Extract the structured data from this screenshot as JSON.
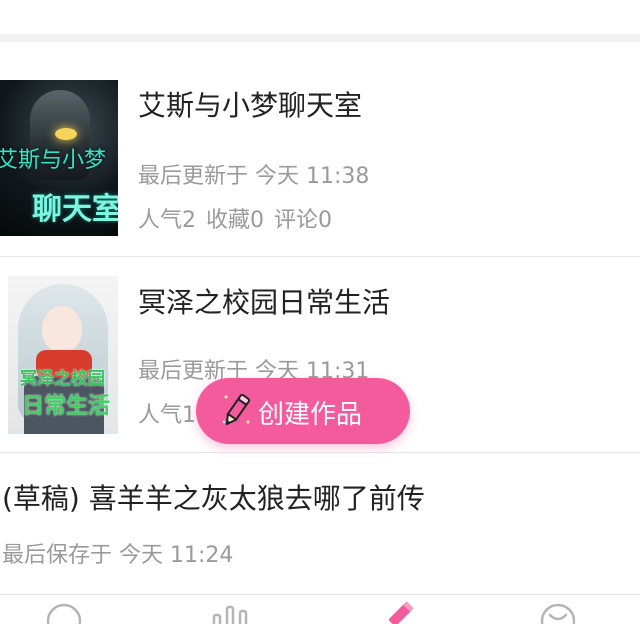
{
  "works": [
    {
      "title": "艾斯与小梦聊天室",
      "updated": "最后更新于 今天 11:38",
      "stats": {
        "popularity": "人气2",
        "favorites": "收藏0",
        "comments": "评论0"
      },
      "cover_text_top": "艾斯与小梦",
      "cover_text_big": "聊天室"
    },
    {
      "title": "冥泽之校园日常生活",
      "updated": "最后更新于 今天 11:31",
      "stats": {
        "popularity": "人气1"
      },
      "cover_text_top": "冥泽之校园",
      "cover_text_big": "日常生活"
    }
  ],
  "draft": {
    "title": "(草稿) 喜羊羊之灰太狼去哪了前传",
    "saved": "最后保存于 今天 11:24"
  },
  "fab": {
    "label": "创建作品",
    "icon": "pencil-icon"
  },
  "tabbar": {
    "tabs": [
      {
        "icon": "chat-bubble-icon"
      },
      {
        "icon": "bar-chart-icon"
      },
      {
        "icon": "pencil-icon",
        "active": true
      },
      {
        "icon": "profile-icon"
      }
    ]
  },
  "colors": {
    "accent": "#f45b9c",
    "title_text": "#222222",
    "meta_text": "#9a9a9a",
    "divider": "#e6e6e6",
    "tab_icon": "#b5b5b5"
  }
}
